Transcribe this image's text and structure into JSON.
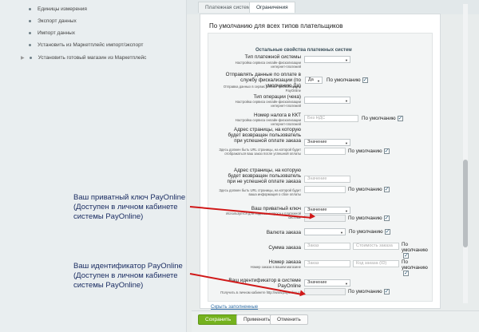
{
  "sidebar": {
    "items": [
      {
        "label": "Единицы измерения"
      },
      {
        "label": "Экспорт данных"
      },
      {
        "label": "Импорт данных"
      },
      {
        "label": "Установить из Маркетплейс импорт/экспорт"
      },
      {
        "label": "Установить готовый магазин из Маркетплейс"
      }
    ]
  },
  "tabs": [
    {
      "label": "Платежная система"
    },
    {
      "label": "Ограничения"
    }
  ],
  "header": {
    "title": "По умолчанию для всех типов плательщиков"
  },
  "section": {
    "title": "Остальные свойства платежных систем"
  },
  "rows": {
    "cash_type": {
      "label": "Тип платежной системы",
      "hint": "Настройка сервиса онлайн-фискализации интернет-платежей"
    },
    "fiscal": {
      "label": "Отправлять данные по оплате в службу фискализации (по умолчанию Да)",
      "hint": "Отправка данных в сервис онлайн-фискализации PayOnline",
      "value": "Да",
      "default": "По умолчанию"
    },
    "op_type": {
      "label": "Тип операции (чека)",
      "hint": "Настройка сервиса онлайн-фискализации интернет-платежей"
    },
    "vat": {
      "label": "Номер налога в ККТ",
      "hint": "Настройка сервиса онлайн-фискализации интернет-платежей",
      "value": "Без НДС",
      "default": "По умолчанию"
    },
    "success_url": {
      "label": "Адрес страницы, на которую будет возвращен пользователь при успешной оплате заказа",
      "hint": "Здесь должен быть URL страницы, на которой будет отображаться ваш заказ после успешной оплаты",
      "select": "Значение",
      "default": "По умолчанию"
    },
    "fail_url": {
      "label": "Адрес страницы, на которую будет возвращен пользователь при не успешной оплате заказа",
      "hint": "Здесь должен быть URL страницы, на которой будет ваша информация о сбое оплаты",
      "select": "Значение",
      "default": "По умолчанию"
    },
    "private_key": {
      "label": "Ваш приватный ключ",
      "hint": "Используется для подписи запроса к платежной системе",
      "select": "Значение",
      "default": "По умолчанию"
    },
    "currency": {
      "label": "Валюта заказа",
      "default": "По умолчанию"
    },
    "sum": {
      "label": "Сумма заказа",
      "select": "Заказ",
      "value": "Стоимость заказа",
      "default": "По умолчанию"
    },
    "order_num": {
      "label": "Номер заказа",
      "hint": "Номер заказа в вашем магазине",
      "select": "Заказ",
      "value": "Код заказа (ID)",
      "default": "По умолчанию"
    },
    "merchant_id": {
      "label": "Ваш идентификатор в системе PayOnline",
      "hint": "Получить в личном кабинете http://www.payonline.ru",
      "select": "Значение",
      "default": "По умолчанию"
    }
  },
  "annotations": [
    {
      "text": "Ваш приватный ключ PayOnline (Доступен в личном кабинете системы PayOnline)"
    },
    {
      "text": "Ваш идентификатор PayOnline (Доступен в личном кабинете системы PayOnline)"
    }
  ],
  "links": {
    "hide": "Скрыть заполненные"
  },
  "buttons": {
    "save": "Сохранить",
    "apply": "Применить",
    "cancel": "Отменить"
  },
  "colors": {
    "accent_green": "#75b21e",
    "arrow_red": "#d01818",
    "annotation_text": "#1b2d62",
    "link": "#3270a8"
  }
}
